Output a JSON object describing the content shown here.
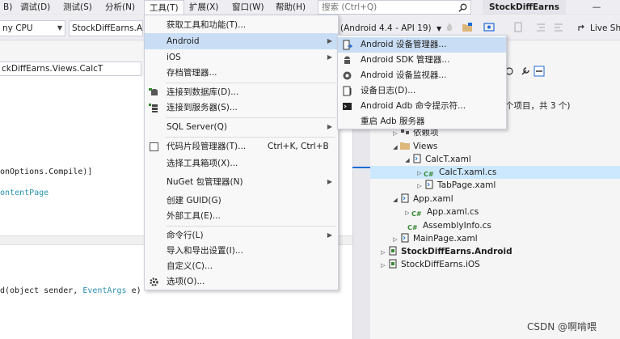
{
  "menubar": {
    "items": [
      "B)",
      "调试(D)",
      "测试(S)",
      "分析(N)",
      "工具(T)",
      "扩展(X)",
      "窗口(W)",
      "帮助(H)"
    ],
    "search_placeholder": "搜索 (Ctrl+Q)",
    "app_title": "StockDiffEarns",
    "minimize": "—"
  },
  "toolbar": {
    "platform": "ny CPU",
    "project": "StockDiffEarns.An",
    "android_target": "(Android 4.4 - API 19)",
    "live_share": "Live Sha"
  },
  "editor": {
    "doc_tab": "ckDiffEarns.Views.CalcT",
    "lines": {
      "compile": "onOptions.Compile)]",
      "content_page": "ontentPage",
      "handler_prefix": "d(object sender, ",
      "handler_type": "EventArgs",
      "handler_suffix": " e)"
    }
  },
  "tools_menu": {
    "items": [
      {
        "label": "获取工具和功能(T)...",
        "shortcut": "",
        "submenu": false
      },
      {
        "label": "Android",
        "shortcut": "",
        "submenu": true
      },
      {
        "label": "iOS",
        "shortcut": "",
        "submenu": true
      },
      {
        "label": "存档管理器...",
        "shortcut": "",
        "submenu": false
      },
      {
        "label": "连接到数据库(D)...",
        "shortcut": "",
        "submenu": false
      },
      {
        "label": "连接到服务器(S)...",
        "shortcut": "",
        "submenu": false
      },
      {
        "label": "SQL Server(Q)",
        "shortcut": "",
        "submenu": true
      },
      {
        "label": "代码片段管理器(T)...",
        "shortcut": "Ctrl+K, Ctrl+B",
        "submenu": false
      },
      {
        "label": "选择工具箱项(X)...",
        "shortcut": "",
        "submenu": false
      },
      {
        "label": "NuGet 包管理器(N)",
        "shortcut": "",
        "submenu": true
      },
      {
        "label": "创建 GUID(G)",
        "shortcut": "",
        "submenu": false
      },
      {
        "label": "外部工具(E)...",
        "shortcut": "",
        "submenu": false
      },
      {
        "label": "命令行(L)",
        "shortcut": "",
        "submenu": true
      },
      {
        "label": "导入和导出设置(I)...",
        "shortcut": "",
        "submenu": false
      },
      {
        "label": "自定义(C)...",
        "shortcut": "",
        "submenu": false
      },
      {
        "label": "选项(O)...",
        "shortcut": "",
        "submenu": false
      }
    ]
  },
  "android_menu": {
    "items": [
      {
        "label": "Android 设备管理器...",
        "icon": "device-manager-icon"
      },
      {
        "label": "Android SDK 管理器...",
        "icon": "sdk-manager-icon"
      },
      {
        "label": "Android 设备监视器...",
        "icon": "device-monitor-icon"
      },
      {
        "label": "设备日志(D)...",
        "icon": "device-log-icon"
      },
      {
        "label": "Android Adb 命令提示符...",
        "icon": "adb-prompt-icon"
      },
      {
        "label": "重启 Adb 服务器",
        "icon": ""
      }
    ]
  },
  "solution_explorer": {
    "summary": "个项目，共 3 个)",
    "nodes": [
      {
        "label": "依赖项"
      },
      {
        "label": "Views"
      },
      {
        "label": "CalcT.xaml"
      },
      {
        "label": "CalcT.xaml.cs"
      },
      {
        "label": "TabPage.xaml"
      },
      {
        "label": "App.xaml"
      },
      {
        "label": "App.xaml.cs"
      },
      {
        "label": "AssemblyInfo.cs"
      },
      {
        "label": "MainPage.xaml"
      },
      {
        "label": "StockDiffEarns.Android"
      },
      {
        "label": "StockDiffEarns.iOS"
      }
    ]
  },
  "watermark": "CSDN @啊啃喂",
  "colors": {
    "accent": "#1e6bd6",
    "menu_hover": "#c9def5",
    "selection": "#cce8ff",
    "code_type": "#2b91af"
  }
}
